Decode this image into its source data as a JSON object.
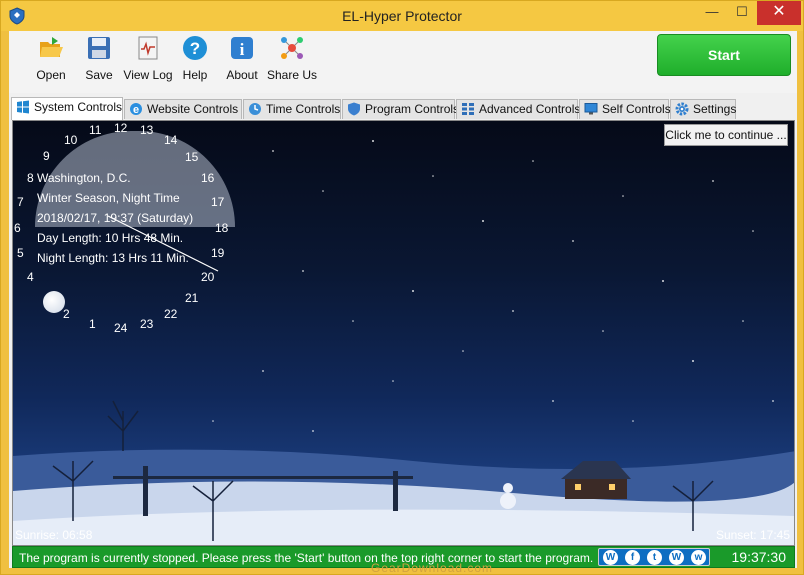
{
  "window": {
    "title": "EL-Hyper Protector"
  },
  "toolbar": {
    "items": [
      {
        "label": "Open",
        "icon": "folder-icon"
      },
      {
        "label": "Save",
        "icon": "floppy-icon"
      },
      {
        "label": "View Log",
        "icon": "log-icon"
      },
      {
        "label": "Help",
        "icon": "help-icon"
      },
      {
        "label": "About",
        "icon": "info-icon"
      },
      {
        "label": "Share Us",
        "icon": "share-icon"
      }
    ],
    "start_label": "Start"
  },
  "tabs": [
    {
      "label": "System Controls",
      "icon": "windows-icon",
      "active": true
    },
    {
      "label": "Website Controls",
      "icon": "ie-icon"
    },
    {
      "label": "Time Controls",
      "icon": "clock-icon"
    },
    {
      "label": "Program Controls",
      "icon": "shield-icon"
    },
    {
      "label": "Advanced Controls",
      "icon": "grid-icon"
    },
    {
      "label": "Self Controls",
      "icon": "monitor-icon"
    },
    {
      "label": "Settings",
      "icon": "gear-icon"
    }
  ],
  "scene": {
    "continue_label": "Click me to continue ...",
    "location": "Washington, D.C.",
    "season": "Winter Season, Night Time",
    "datetime": "2018/02/17, 19:37 (Saturday)",
    "day_length": "Day Length: 10 Hrs 48 Min.",
    "night_length": "Night Length: 13 Hrs 11 Min.",
    "hours": [
      "11",
      "12",
      "13",
      "10",
      "14",
      "9",
      "15",
      "8",
      "16",
      "7",
      "17",
      "6",
      "18",
      "5",
      "19",
      "4",
      "20",
      "21",
      "2",
      "22",
      "1",
      "24",
      "23"
    ],
    "sunrise": "Sunrise: 06:58",
    "sunset": "Sunset: 17:45"
  },
  "status": {
    "message": "The program is currently stopped. Please press the 'Start' button on the top right corner to start the program.",
    "clock": "19:37:30",
    "social": [
      "W",
      "f",
      "t",
      "W",
      "w"
    ]
  },
  "watermark": "GearDownload.com",
  "colors": {
    "start_green": "#2fbe36",
    "status_green": "#1a9a2a",
    "title_yellow": "#f5c842"
  }
}
